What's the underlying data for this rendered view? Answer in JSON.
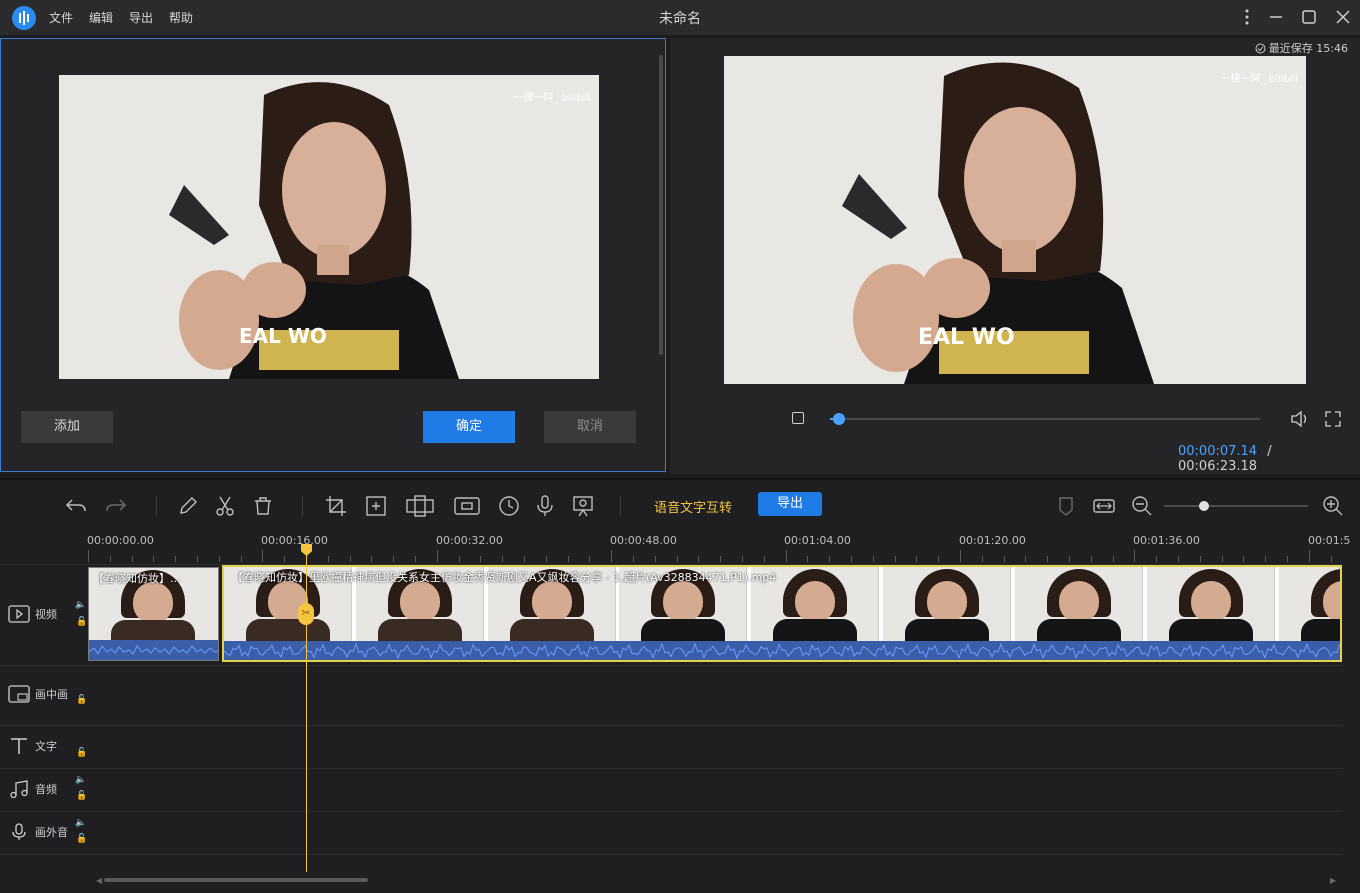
{
  "app": {
    "title": "未命名",
    "menu": [
      "文件",
      "编辑",
      "导出",
      "帮助"
    ],
    "autosave": "最近保存 15:46"
  },
  "left_panel": {
    "buttons": {
      "add": "添加",
      "confirm": "确定",
      "cancel": "取消"
    },
    "watermark": "一棵一阿_ bilibili"
  },
  "right_panel": {
    "watermark": "一棵一阿_ bilibili",
    "current_time": "00:00:07.14",
    "separator": "/",
    "total_time": "00:06:23.18",
    "playback_progress": 0.02
  },
  "timeline": {
    "speech_text_label": "语音文字互转",
    "export_label": "导出",
    "ruler": [
      "00:00:00.00",
      "00:00:16.00",
      "00:00:32.00",
      "00:00:48.00",
      "00:01:04.00",
      "00:01:20.00",
      "00:01:36.00",
      "00:01:5"
    ],
    "tracks": {
      "video": "视频",
      "pip": "画中画",
      "text": "文字",
      "audio": "音频",
      "voiceover": "画外音"
    },
    "clip1_title": "【春晓知仿妆】...",
    "clip2_title": "【春晓知仿妆】里欧撞精神病但没关系女主仿妆金秀贤新剧又A又飒妆容分享 - 1.超片(Av328834471,P1).mp4",
    "zoom_level": 0.28
  },
  "colors": {
    "accent": "#1f7be6",
    "timecode": "#4aa3ff",
    "playhead": "#f5c542",
    "clip_border": "#e6d24a",
    "waveform": "#3a6fd8",
    "speech_label": "#f5c542"
  },
  "icons": [
    "logo-icon",
    "more-icon",
    "minimize-icon",
    "maximize-icon",
    "close-icon",
    "check-circle-icon",
    "stop-icon",
    "volume-icon",
    "fullscreen-icon",
    "undo-icon",
    "redo-icon",
    "edit-icon",
    "scissors-icon",
    "trash-icon",
    "crop-icon",
    "zoom-icon",
    "mosaic-icon",
    "freeze-icon",
    "speed-icon",
    "mic-icon",
    "webcam-icon",
    "marker-icon",
    "fit-icon",
    "zoom-out-icon",
    "zoom-in-icon"
  ]
}
